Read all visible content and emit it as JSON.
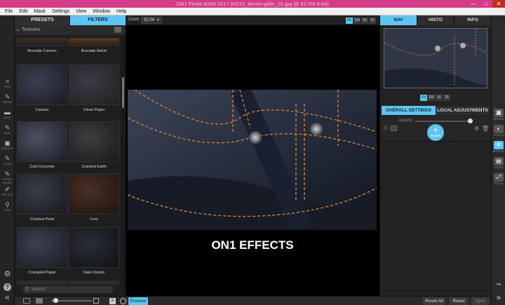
{
  "window": {
    "title": "ON1 Photo RAW 2017 (H215_denim-glide_01.jpg @ 52.0% 8-bit)",
    "accent": "#d43c8a",
    "controls": [
      "—",
      "□",
      "✕"
    ]
  },
  "menu": [
    "File",
    "Edit",
    "Mask",
    "Settings",
    "View",
    "Window",
    "Help"
  ],
  "left_tools": [
    "CROP",
    "REFINE",
    "LOCAL",
    "MASK",
    "RETOUCH",
    "CLONE",
    "REFINE BRUSH",
    "RED EYE",
    "VIEW"
  ],
  "panel": {
    "tabs": [
      "PRESETS",
      "FILTERS"
    ],
    "active_tab": "FILTERS",
    "category": "Textures",
    "thumbnails": [
      "Brocade Corners",
      "Brocade Warm",
      "Canvas",
      "Clean Paper",
      "Cool Concrete",
      "Cracked Earth",
      "Cracked Paint",
      "Croc",
      "Crumpled Paper",
      "Dark Clouds"
    ],
    "search_placeholder": "Search"
  },
  "toolbar": {
    "zoom_label": "Zoom",
    "zoom_value": "52.04",
    "zoom_buttons": [
      "Fit",
      "100",
      "50",
      "25"
    ]
  },
  "overlay_caption": "ON1 EFFECTS",
  "nav": {
    "tabs": [
      "NAV",
      "HISTO",
      "INFO"
    ],
    "active_tab": "NAV",
    "zoom_buttons": [
      "Fit",
      "100",
      "50",
      "25"
    ]
  },
  "settings": {
    "tabs": [
      "OVERALL SETTINGS",
      "LOCAL ADJUSTMENTS"
    ],
    "opacity_label": "Opacity",
    "opacity_value": 100,
    "add_filter_label": "FILTER"
  },
  "right_modules": [
    "BROWSE",
    "DEVELOP",
    "EFFECTS",
    "LAYERS",
    "RESIZE"
  ],
  "bottom": {
    "preview_label": "Preview",
    "reset_all_label": "Reset All",
    "reset_label": "Reset",
    "sync_label": "Sync"
  },
  "colors": {
    "tab_active": "#5fc4ef",
    "panel_bg": "#1e1e1e",
    "titlebar": "#d43c8a"
  }
}
